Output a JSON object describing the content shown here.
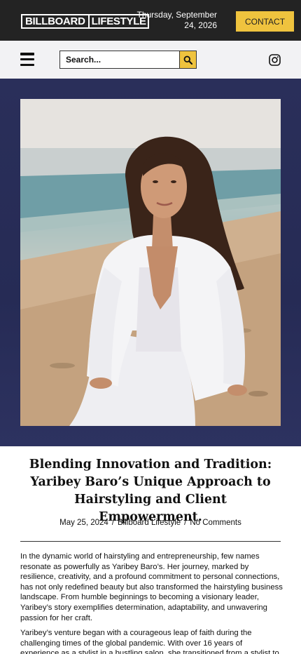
{
  "header": {
    "logo_left": "BILLBOARD",
    "logo_right": "LIFESTYLE",
    "date_line1": "Thursday, September",
    "date_line2": "24, 2026",
    "contact_label": "CONTACT"
  },
  "nav": {
    "search_placeholder": "Search...",
    "menu_icon": "hamburger-menu-icon",
    "search_icon": "search-icon",
    "social_icon": "instagram-icon"
  },
  "colors": {
    "topbar": "#232323",
    "accent": "#efc33e",
    "navbar": "#f2f2f4",
    "hero_bg": "#262b55"
  },
  "article": {
    "title": "Blending Innovation and Tradition: Yaribey Baro’s Unique Approach to Hairstyling and Client Empowerment.",
    "date": "May 25, 2024",
    "category": "Billboard Lifestyle",
    "comments": "No Comments",
    "paragraphs": [
      "In the dynamic world of hairstyling and entrepreneurship, few names resonate as powerfully as Yaribey Baro’s. Her journey, marked by resilience, creativity, and a profound commitment to personal connections, has not only redefined beauty but also transformed the hairstyling business landscape. From humble beginnings to becoming a visionary leader, Yaribey’s story exemplifies determination, adaptability, and unwavering passion for her craft.",
      "Yaribey’s venture began with a courageous leap of faith during the challenging times of the global pandemic. With over 16 years of experience as a stylist in a bustling salon, she transitioned from a stylist to"
    ]
  }
}
